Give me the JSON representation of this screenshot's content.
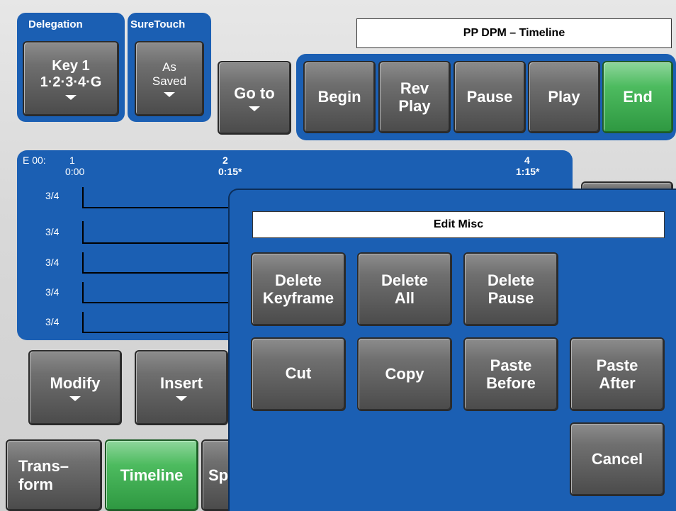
{
  "delegation": {
    "label": "Delegation",
    "button": "Key 1\n1·2·3·4·G"
  },
  "suretouch": {
    "label": "SureTouch",
    "button": "As\nSaved"
  },
  "goto_button": "Go to",
  "header_title": "PP DPM – Timeline",
  "transport": {
    "begin": "Begin",
    "rev_play": "Rev\nPlay",
    "pause": "Pause",
    "play": "Play",
    "end": "End"
  },
  "timeline": {
    "effect": "E 00:",
    "keyframes": [
      {
        "num": "1",
        "time": "0:00"
      },
      {
        "num": "2",
        "time": "0:15*"
      },
      {
        "num": "4",
        "time": "1:15*"
      }
    ],
    "rows": [
      "3/4",
      "3/4",
      "3/4",
      "3/4",
      "3/4"
    ]
  },
  "bottom": {
    "modify": "Modify",
    "insert": "Insert",
    "transform": "Trans–\nform",
    "timeline": "Timeline",
    "sp": "Sp"
  },
  "dialog": {
    "title": "Edit Misc",
    "delete_keyframe": "Delete\nKeyframe",
    "delete_all": "Delete\nAll",
    "delete_pause": "Delete\nPause",
    "cut": "Cut",
    "copy": "Copy",
    "paste_before": "Paste\nBefore",
    "paste_after": "Paste\nAfter",
    "cancel": "Cancel"
  },
  "colors": {
    "panel_blue": "#1b5fb3",
    "active_green": "#4dbb5f",
    "button_gray": "#6f6f6f"
  }
}
